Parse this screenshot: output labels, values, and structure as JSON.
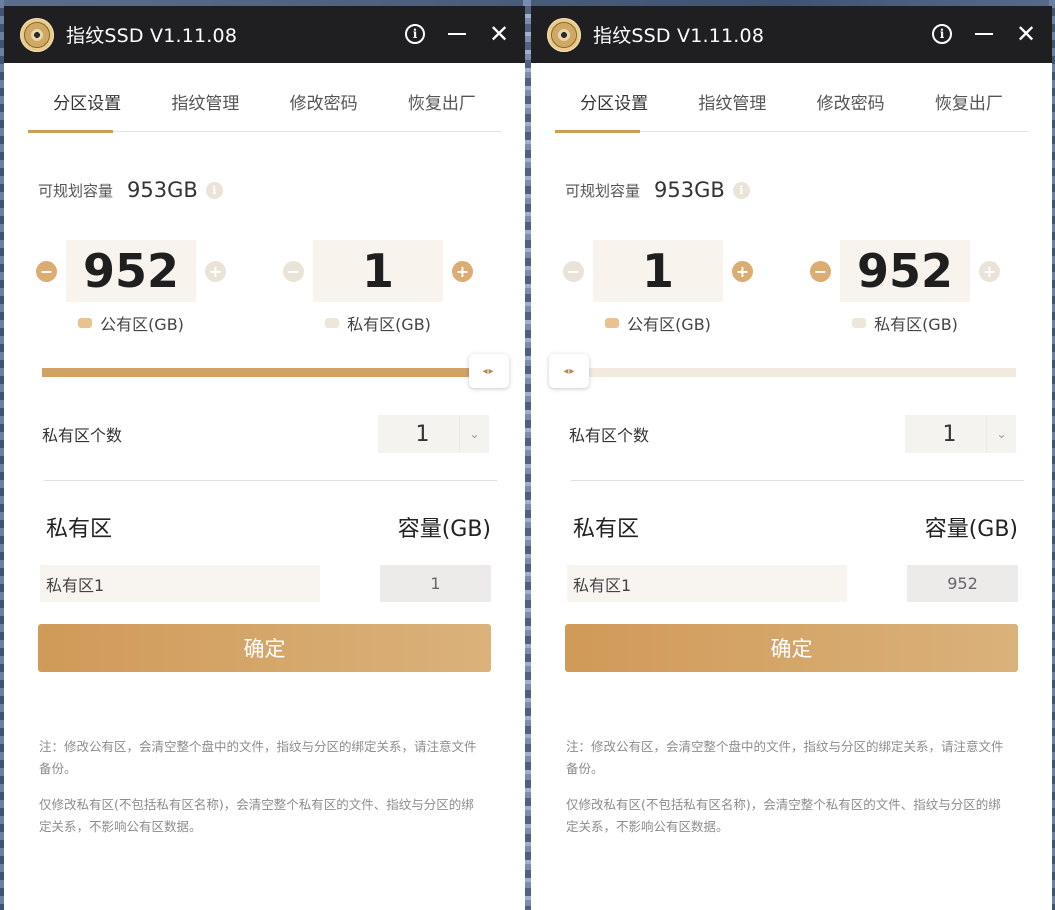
{
  "windows": [
    {
      "title": "指纹SSD V1.11.08",
      "tabs": [
        {
          "label": "分区设置"
        },
        {
          "label": "指纹管理"
        },
        {
          "label": "修改密码"
        },
        {
          "label": "恢复出厂"
        }
      ],
      "capacity": {
        "label": "可规划容量",
        "value": "953GB"
      },
      "public": {
        "value": "952",
        "legend": "公有区(GB)",
        "minus_enabled": true,
        "plus_enabled": false
      },
      "private": {
        "value": "1",
        "legend": "私有区(GB)",
        "minus_enabled": false,
        "plus_enabled": true
      },
      "slider": {
        "public_fraction": 0.999
      },
      "private_count": {
        "label": "私有区个数",
        "value": "1"
      },
      "list": {
        "col_name": "私有区",
        "col_size": "容量(GB)",
        "rows": [
          {
            "name": "私有区1",
            "size": "1"
          }
        ]
      },
      "confirm_label": "确定",
      "notes": [
        "注：修改公有区，会清空整个盘中的文件，指纹与分区的绑定关系，请注意文件备份。",
        "仅修改私有区(不包括私有区名称)，会清空整个私有区的文件、指纹与分区的绑定关系，不影响公有区数据。"
      ]
    },
    {
      "title": "指纹SSD V1.11.08",
      "tabs": [
        {
          "label": "分区设置"
        },
        {
          "label": "指纹管理"
        },
        {
          "label": "修改密码"
        },
        {
          "label": "恢复出厂"
        }
      ],
      "capacity": {
        "label": "可规划容量",
        "value": "953GB"
      },
      "public": {
        "value": "1",
        "legend": "公有区(GB)",
        "minus_enabled": false,
        "plus_enabled": true
      },
      "private": {
        "value": "952",
        "legend": "私有区(GB)",
        "minus_enabled": true,
        "plus_enabled": false
      },
      "slider": {
        "public_fraction": 0.001
      },
      "private_count": {
        "label": "私有区个数",
        "value": "1"
      },
      "list": {
        "col_name": "私有区",
        "col_size": "容量(GB)",
        "rows": [
          {
            "name": "私有区1",
            "size": "952"
          }
        ]
      },
      "confirm_label": "确定",
      "notes": [
        "注：修改公有区，会清空整个盘中的文件，指纹与分区的绑定关系，请注意文件备份。",
        "仅修改私有区(不包括私有区名称)，会清空整个私有区的文件、指纹与分区的绑定关系，不影响公有区数据。"
      ]
    }
  ],
  "colors": {
    "accent": "#d09b57",
    "titlebar": "#1f1f22",
    "public_swatch": "#e8c38f",
    "private_swatch": "#efe6da"
  },
  "icons": {
    "info": "i",
    "plus": "+",
    "minus": "−",
    "close": "✕",
    "chevron": "⌄",
    "thumb": "◂▸"
  }
}
